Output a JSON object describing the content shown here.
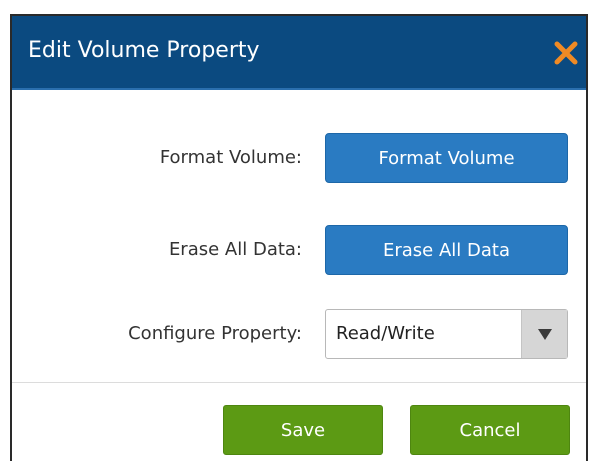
{
  "dialog": {
    "title": "Edit Volume Property",
    "close_icon": "close-icon",
    "colors": {
      "titlebar": "#0b4a80",
      "close": "#f08a24",
      "primary_button": "#2a7bc2",
      "action_button": "#5c9a14"
    }
  },
  "rows": {
    "format_label": "Format Volume:",
    "format_button": "Format Volume",
    "erase_label": "Erase All Data:",
    "erase_button": "Erase All Data",
    "configure_label": "Configure Property:",
    "configure_value": "Read/Write",
    "configure_arrow_icon": "triangle-down-icon"
  },
  "footer": {
    "save_label": "Save",
    "cancel_label": "Cancel"
  }
}
